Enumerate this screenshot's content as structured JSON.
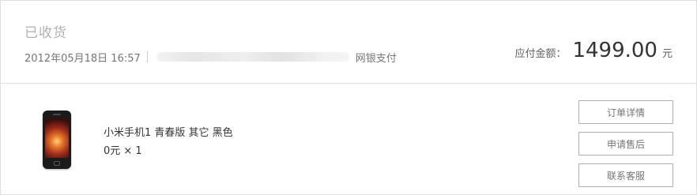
{
  "order": {
    "status": "已收货",
    "datetime": "2012年05月18日 16:57",
    "payment_method": "网银支付",
    "amount_label": "应付金额：",
    "amount_value": "1499.00",
    "amount_unit": "元"
  },
  "item": {
    "name": "小米手机1 青春版 其它 黑色",
    "price_qty": "0元 × 1",
    "image_icon": "phone-image"
  },
  "actions": {
    "order_detail": "订单详情",
    "apply_after_sales": "申请售后",
    "contact_service": "联系客服"
  },
  "colors": {
    "border": "#e0e0e0",
    "status_text": "#b0b0b0",
    "button_border": "#b0b0b0"
  }
}
